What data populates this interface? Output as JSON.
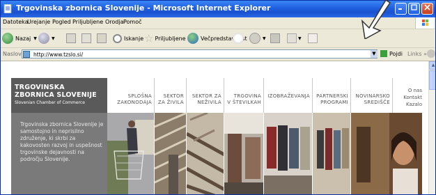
{
  "window": {
    "title": "Trgovinska zbornica Slovenije - Microsoft Internet Explorer"
  },
  "menubar": {
    "items": [
      "Datoteka",
      "Urejanje",
      "Pogled",
      "Priljubljene",
      "Orodja",
      "Pomoč"
    ]
  },
  "toolbar": {
    "back": "Nazaj",
    "search": "Iskanje",
    "favorites": "Priljubljene",
    "media": "Večpredstavnost"
  },
  "addressbar": {
    "label": "Naslov",
    "url": "http://www.tzslo.si/",
    "go": "Pojdi",
    "links": "Links"
  },
  "site": {
    "logo": {
      "line1": "TRGOVINSKA",
      "line2": "ZBORNICA SLOVENIJE",
      "line3": "Slovenian Chamber of Commerce"
    },
    "nav": [
      {
        "l1": "SPLOŠNA",
        "l2": "ZAKONODAJA"
      },
      {
        "l1": "SEKTOR",
        "l2": "ZA ŽIVILA"
      },
      {
        "l1": "SEKTOR ZA",
        "l2": "NEŽIVILA"
      },
      {
        "l1": "TRGOVINA",
        "l2": "V ŠTEVILKAH"
      },
      {
        "l1": "IZOBRAŽEVANJA",
        "l2": ""
      },
      {
        "l1": "PARTNERSKI",
        "l2": "PROGRAMI"
      },
      {
        "l1": "NOVINARSKO",
        "l2": "SREDIŠČE"
      }
    ],
    "util": [
      "O nas",
      "Kontakt",
      "Kazalo"
    ],
    "intro": "Trgovinska zbornica Slovenije je samostojno in neprisilno združenje, ki skrbi za kakovosten razvoj in uspešnost trgovinske dejavnosti na področju Slovenije."
  },
  "colors": {
    "titlebar": "#1f5fe0",
    "logo_bg": "#5a5a5a",
    "sidebar_bg": "#7a7a7a"
  }
}
